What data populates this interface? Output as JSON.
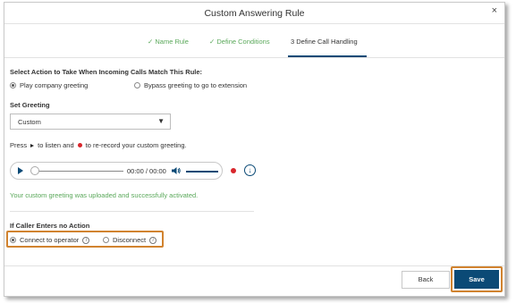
{
  "dialog": {
    "title": "Custom Answering Rule",
    "close_glyph": "×"
  },
  "steps": [
    {
      "label": "✓ Name Rule",
      "state": "done"
    },
    {
      "label": "✓ Define Conditions",
      "state": "done"
    },
    {
      "label": "3  Define Call Handling",
      "state": "active"
    }
  ],
  "action": {
    "label": "Select Action to Take When Incoming Calls Match This Rule:",
    "options": [
      {
        "label": "Play company greeting",
        "selected": true
      },
      {
        "label": "Bypass greeting to go to extension",
        "selected": false
      }
    ]
  },
  "greeting": {
    "label": "Set Greeting",
    "selected_value": "Custom",
    "hint_part1": "Press",
    "hint_part2": "to listen and",
    "hint_part3": "to re-record your custom greeting.",
    "player": {
      "time": "00:00 / 00:00"
    },
    "success_message": "Your custom greeting was uploaded and successfully activated."
  },
  "no_action": {
    "label": "If Caller Enters no Action",
    "options": [
      {
        "label": "Connect to operator",
        "selected": true
      },
      {
        "label": "Disconnect",
        "selected": false
      }
    ]
  },
  "footer": {
    "back_label": "Back",
    "save_label": "Save"
  },
  "colors": {
    "accent": "#0b4a76",
    "success": "#5aa85a",
    "highlight": "#d1832f",
    "record": "#d8262c"
  },
  "icons": [
    "close-icon",
    "check-icon",
    "play-icon",
    "record-icon",
    "speaker-icon",
    "download-icon",
    "info-icon",
    "caret-down-icon"
  ]
}
